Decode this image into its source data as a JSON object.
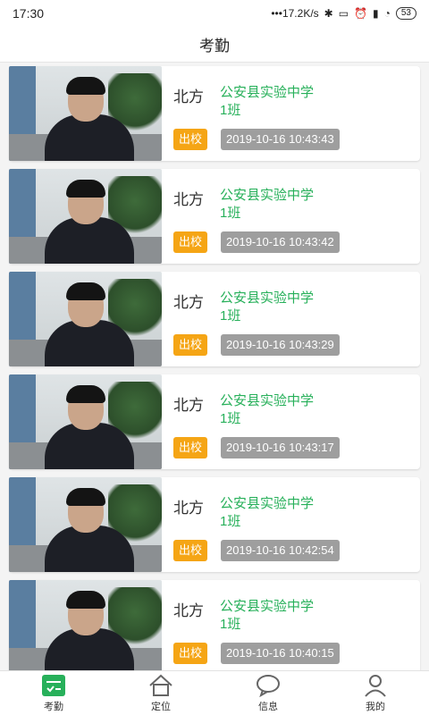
{
  "status_bar": {
    "time": "17:30",
    "network_speed": "•••17.2K/s",
    "battery": "53",
    "icons": [
      "bluetooth-icon",
      "vibrate-icon",
      "alarm-icon",
      "signal-icon",
      "wifi-icon",
      "battery-icon"
    ]
  },
  "header": {
    "title": "考勤"
  },
  "records": [
    {
      "name": "北方",
      "school": "公安县实验中学",
      "class": "1班",
      "status": "出校",
      "time": "2019-10-16 10:43:43"
    },
    {
      "name": "北方",
      "school": "公安县实验中学",
      "class": "1班",
      "status": "出校",
      "time": "2019-10-16 10:43:42"
    },
    {
      "name": "北方",
      "school": "公安县实验中学",
      "class": "1班",
      "status": "出校",
      "time": "2019-10-16 10:43:29"
    },
    {
      "name": "北方",
      "school": "公安县实验中学",
      "class": "1班",
      "status": "出校",
      "time": "2019-10-16 10:43:17"
    },
    {
      "name": "北方",
      "school": "公安县实验中学",
      "class": "1班",
      "status": "出校",
      "time": "2019-10-16 10:42:54"
    },
    {
      "name": "北方",
      "school": "公安县实验中学",
      "class": "1班",
      "status": "出校",
      "time": "2019-10-16 10:40:15"
    }
  ],
  "tabs": [
    {
      "label": "考勤",
      "icon": "attendance-icon",
      "active": true
    },
    {
      "label": "定位",
      "icon": "home-location-icon",
      "active": false
    },
    {
      "label": "信息",
      "icon": "message-bubble-icon",
      "active": false
    },
    {
      "label": "我的",
      "icon": "user-icon",
      "active": false
    }
  ],
  "colors": {
    "accent": "#27b05a",
    "tag": "#f5a515",
    "time_badge": "#9e9e9e"
  }
}
